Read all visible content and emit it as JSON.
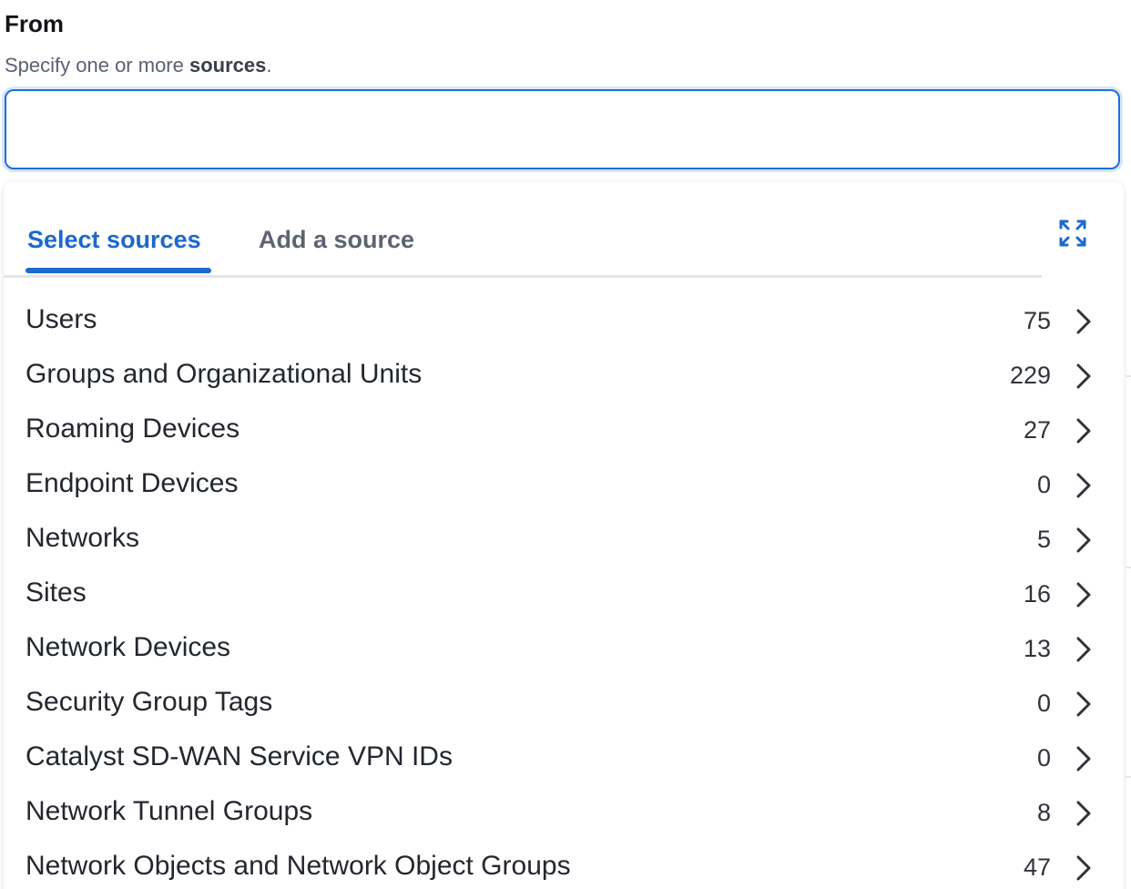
{
  "field": {
    "label": "From",
    "help_prefix": "Specify one or more ",
    "help_bold": "sources",
    "help_suffix": ".",
    "input_value": ""
  },
  "tabs": [
    {
      "label": "Select sources",
      "active": true
    },
    {
      "label": "Add a source",
      "active": false
    }
  ],
  "icons": {
    "expand": "expand-icon",
    "chevron": "chevron-right-icon"
  },
  "colors": {
    "accent": "#1d69cc",
    "input_border": "#1e6fd9"
  },
  "sources": [
    {
      "label": "Users",
      "count": "75"
    },
    {
      "label": "Groups and Organizational Units",
      "count": "229"
    },
    {
      "label": "Roaming Devices",
      "count": "27"
    },
    {
      "label": "Endpoint Devices",
      "count": "0"
    },
    {
      "label": "Networks",
      "count": "5"
    },
    {
      "label": "Sites",
      "count": "16"
    },
    {
      "label": "Network Devices",
      "count": "13"
    },
    {
      "label": "Security Group Tags",
      "count": "0"
    },
    {
      "label": "Catalyst SD-WAN Service VPN IDs",
      "count": "0"
    },
    {
      "label": "Network Tunnel Groups",
      "count": "8"
    },
    {
      "label": "Network Objects and Network Object Groups",
      "count": "47"
    }
  ]
}
